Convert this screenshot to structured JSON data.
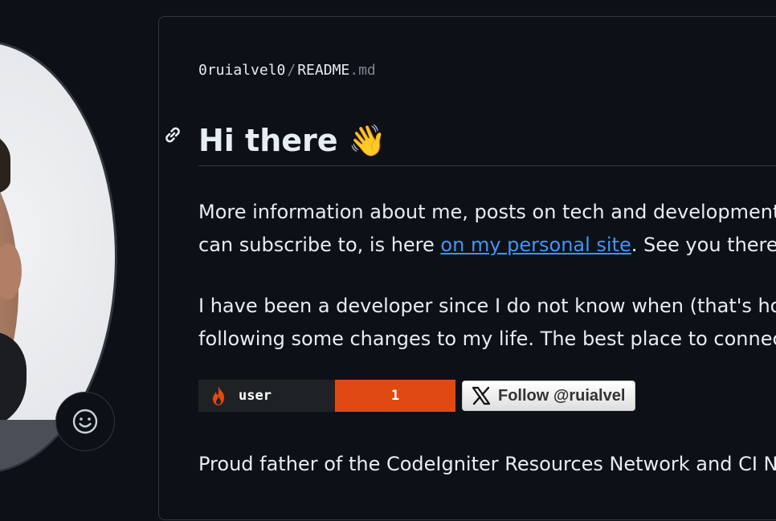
{
  "colors": {
    "background": "#0d1117",
    "text": "#e6edf3",
    "muted": "#7d8590",
    "border": "#30363d",
    "link": "#4493f8",
    "badge_dark": "#1f2225",
    "badge_accent": "#e04a12"
  },
  "profile": {
    "emoji_button_icon": "smiley-icon"
  },
  "readme": {
    "owner": "0ruialvel0",
    "separator": "/",
    "file_name": "README",
    "file_ext": ".md",
    "anchor_icon": "link-icon",
    "heading": "Hi there 👋",
    "paragraph1": {
      "line1": "More information about me, posts on tech and development",
      "line2_before": "can subscribe to, is here ",
      "line2_link": "on my personal site",
      "line2_after": ". See you there!"
    },
    "paragraph2": {
      "line1": "I have been a developer since I do not know when (that's how",
      "line2": "following some changes to my life. The best place to connect"
    },
    "badges": {
      "visitor": {
        "icon": "flame-icon",
        "label": "user",
        "count": "1"
      },
      "follow": {
        "icon": "x-logo-icon",
        "label": "Follow @ruialvel"
      }
    },
    "paragraph3": "Proud father of the CodeIgniter Resources Network and CI Ne"
  }
}
